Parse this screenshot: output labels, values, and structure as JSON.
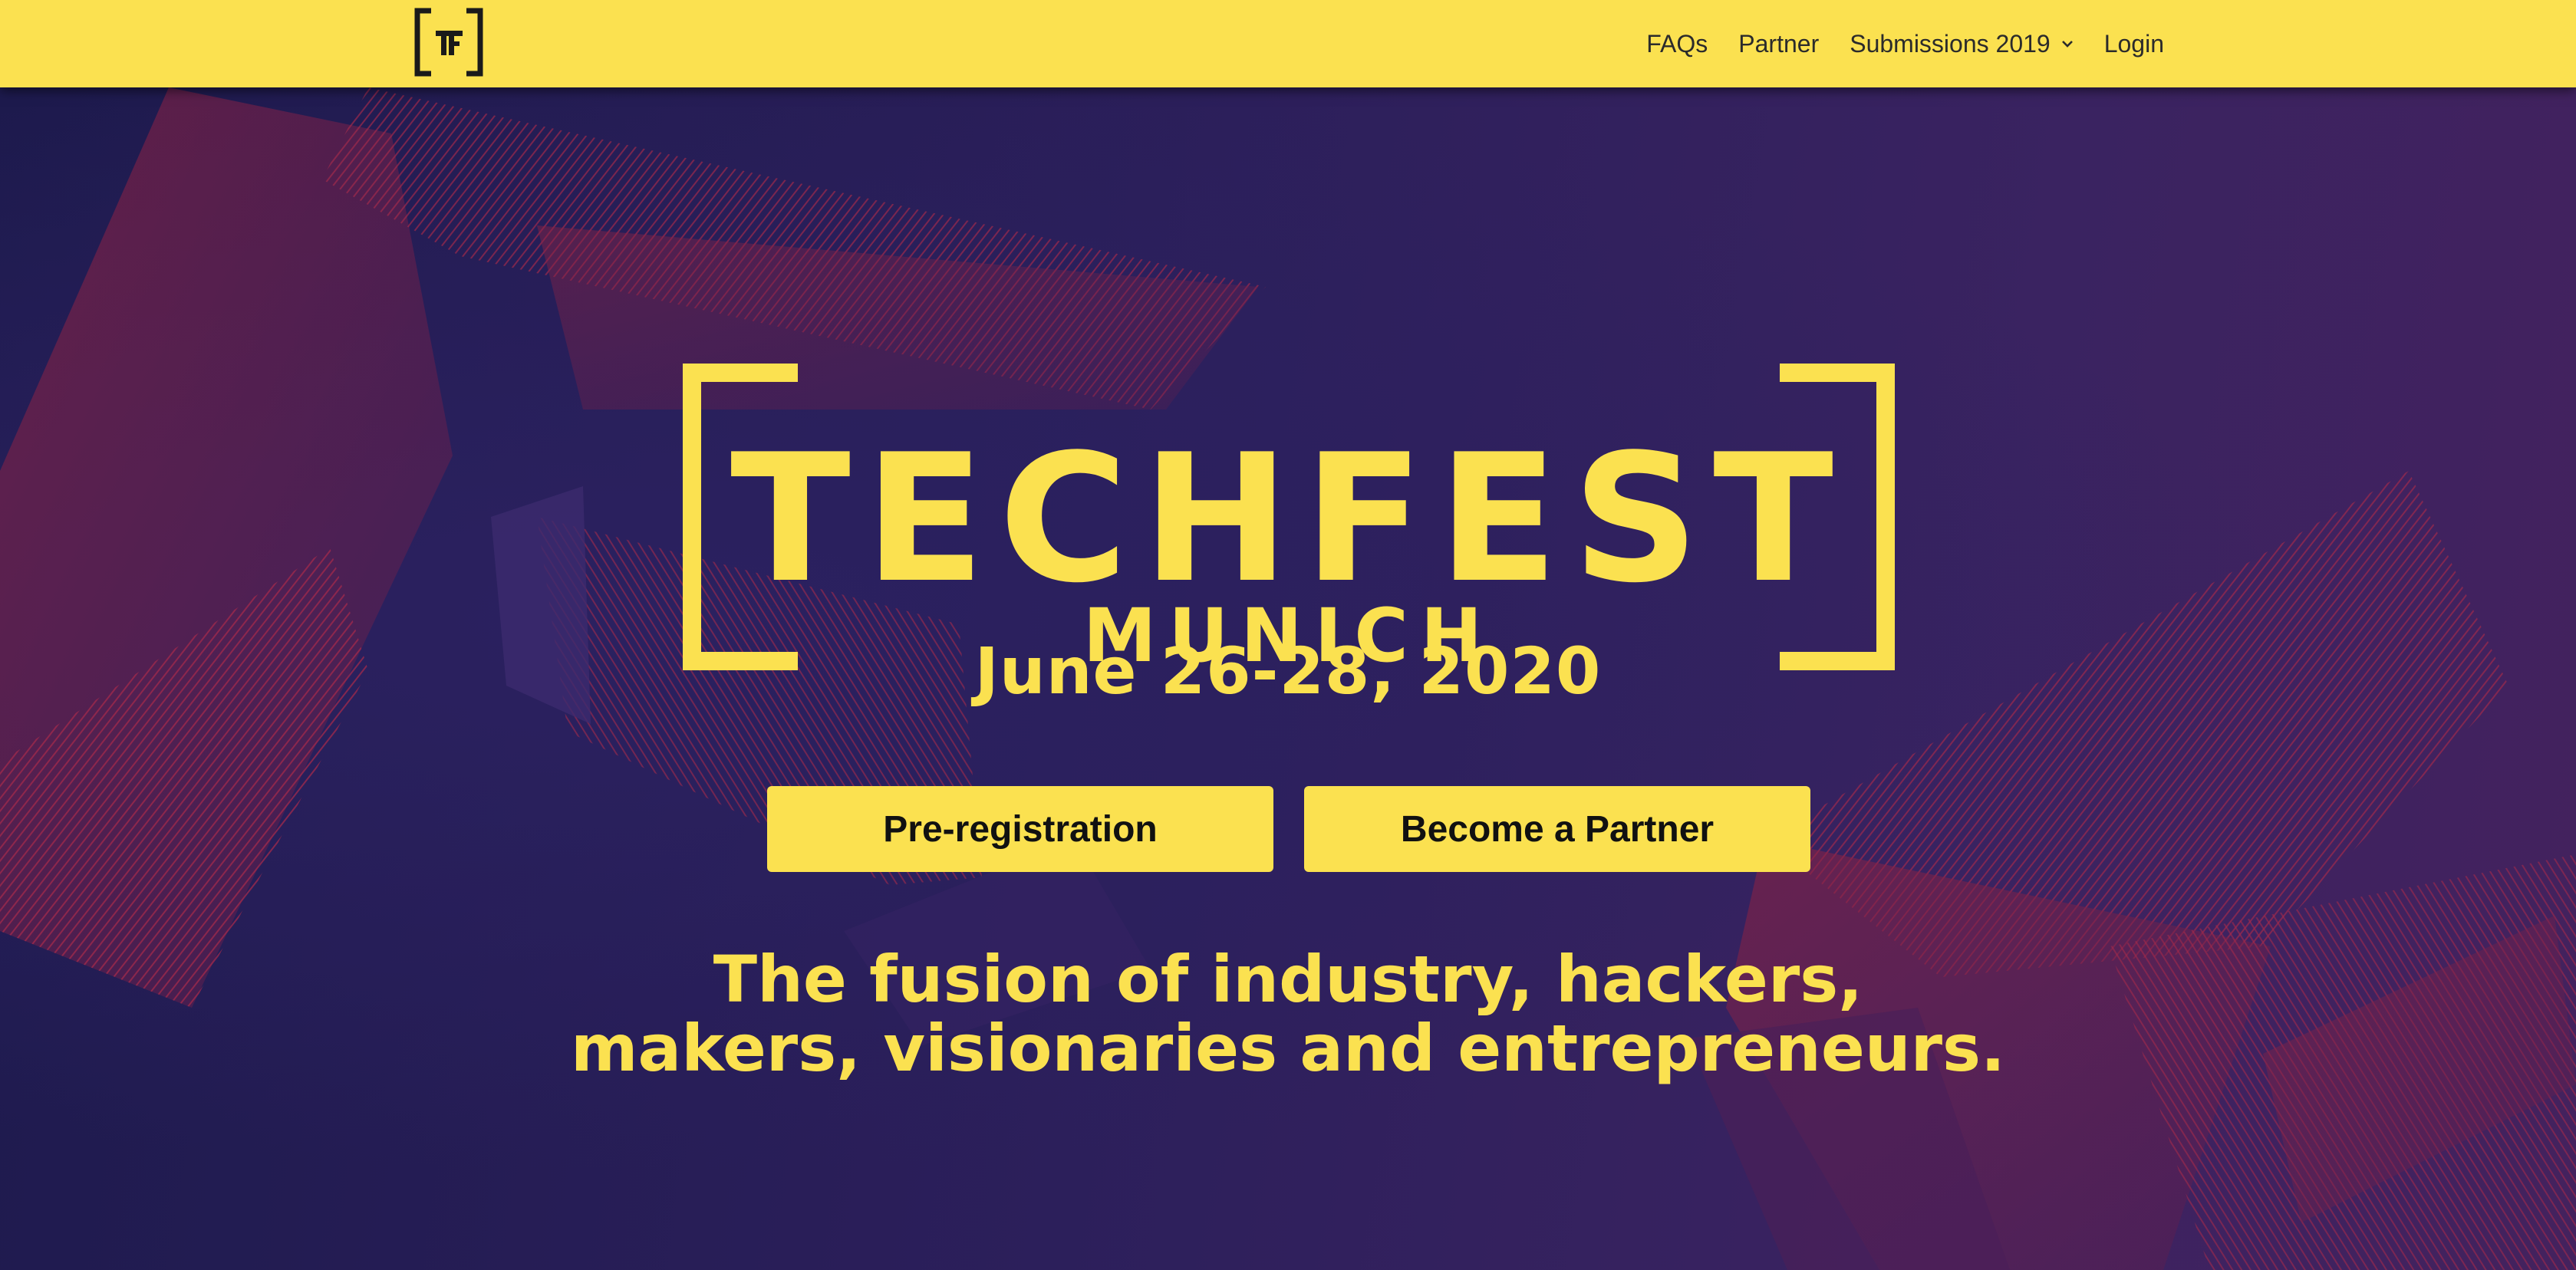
{
  "nav": {
    "logo_text": "TF",
    "items": [
      {
        "label": "FAQs"
      },
      {
        "label": "Partner"
      },
      {
        "label": "Submissions 2019"
      },
      {
        "label": "Login"
      }
    ]
  },
  "hero": {
    "brand_name": "TECHFEST",
    "brand_city": "MUNICH",
    "date": "June 26-28, 2020",
    "buttons": {
      "pre_registration": "Pre-registration",
      "become_partner": "Become a Partner"
    },
    "tagline_line1": "The fusion of industry, hackers,",
    "tagline_line2": "makers, visionaries and entrepreneurs."
  },
  "colors": {
    "accent_yellow": "#fbe150",
    "background_purple": "#2a1d55",
    "art_red": "#8c2244"
  }
}
